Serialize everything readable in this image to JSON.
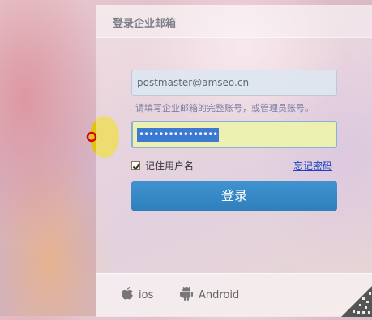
{
  "panel": {
    "title": "登录企业邮箱"
  },
  "form": {
    "username_value": "postmaster@amseo.cn",
    "hint": "请填写企业邮箱的完整账号，或管理员账号。",
    "password_mask": "••••••••••••••••",
    "remember_label": "记住用户名",
    "remember_checked": true,
    "forgot_label": "忘记密码",
    "login_label": "登录"
  },
  "footer": {
    "ios_label": "ios",
    "android_label": "Android"
  },
  "colors": {
    "login_button": "#2f7fbd",
    "password_bg": "#ecf1b2",
    "selection": "#3c79d3",
    "link": "#1a3fbf",
    "cursor_highlight": "#e0c400",
    "cursor_ring": "#d40000"
  },
  "icons": {
    "ios": "apple-icon",
    "android": "android-icon",
    "corner": "qr-code-icon"
  }
}
